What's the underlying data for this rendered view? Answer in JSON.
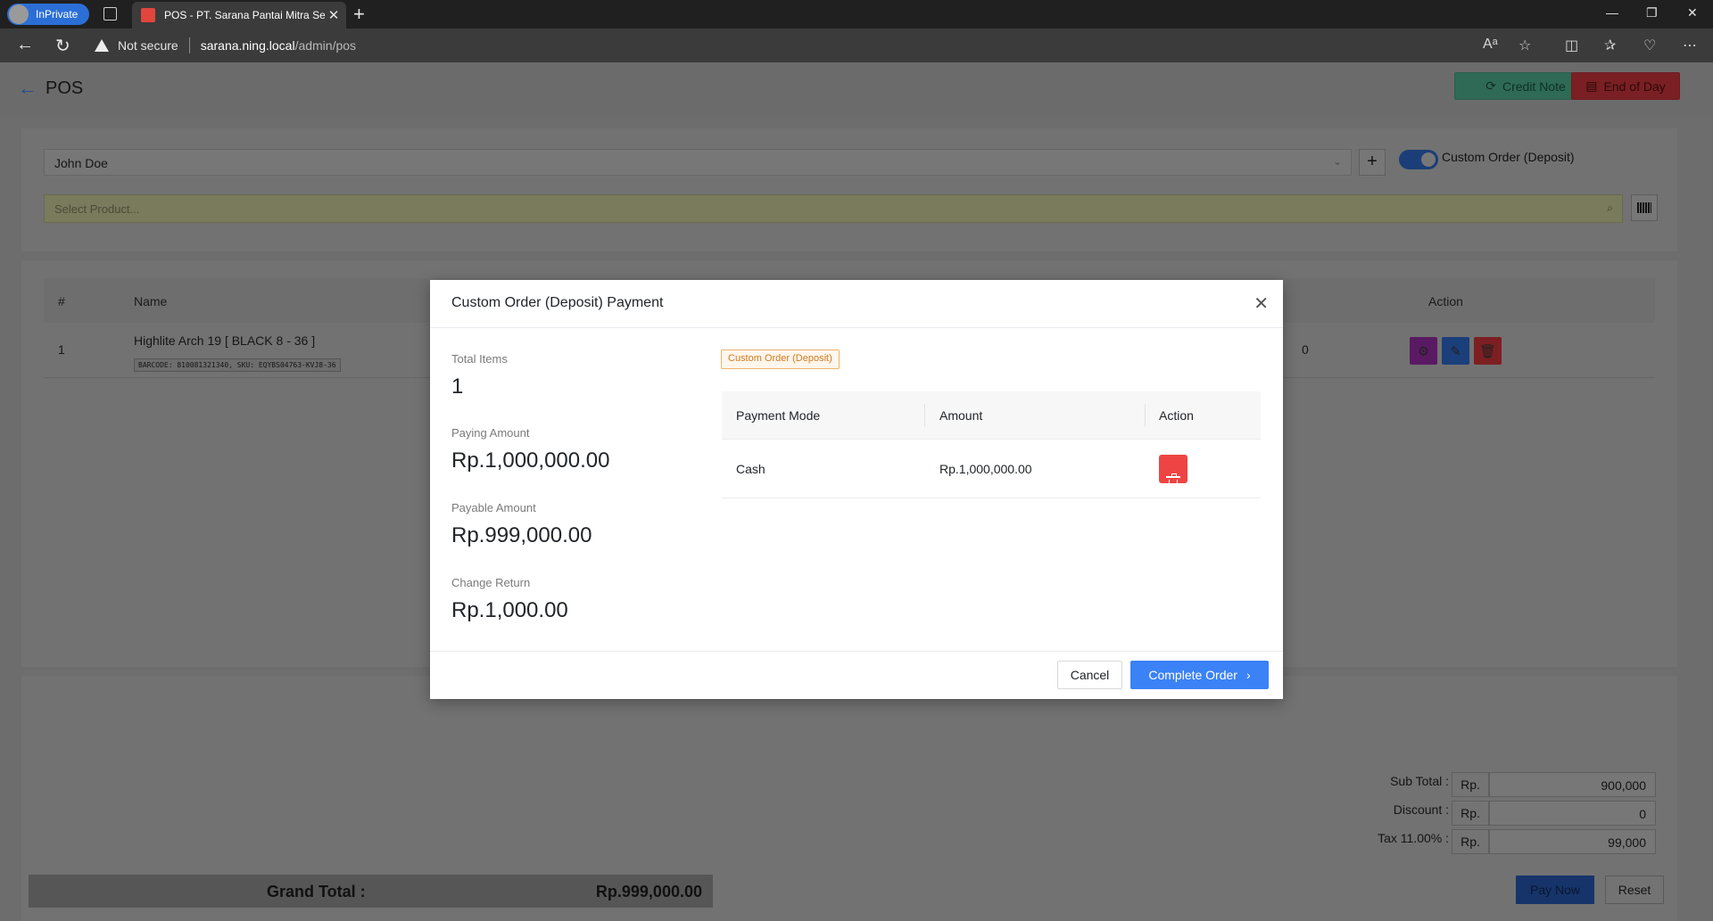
{
  "browser": {
    "inprivate_label": "InPrivate",
    "tab_title": "POS - PT. Sarana Pantai Mitra Se",
    "security_label": "Not secure",
    "url_host": "sarana.ning.local",
    "url_path": "/admin/pos"
  },
  "header": {
    "title": "POS",
    "credit_note_label": "Credit Note",
    "end_of_day_label": "End of Day"
  },
  "order_form": {
    "customer": "John Doe",
    "custom_order_label": "Custom Order (Deposit)",
    "custom_order_enabled": true,
    "product_placeholder": "Select Product..."
  },
  "items_table": {
    "columns": {
      "index": "#",
      "name": "Name",
      "action": "Action"
    },
    "rows": [
      {
        "index": "1",
        "name": "Highlite Arch 19 [ BLACK 8 - 36 ]",
        "meta": "BARCODE: 810081321340, SKU: EQYBS04763-KVJ8-36",
        "partial_value": "0"
      }
    ]
  },
  "totals": {
    "sub_total_label": "Sub Total :",
    "sub_total": "900,000",
    "discount_label": "Discount :",
    "discount": "0",
    "tax_label": "Tax 11.00% :",
    "tax": "99,000",
    "currency_prefix": "Rp.",
    "grand_total_label": "Grand Total :",
    "grand_total": "Rp.999,000.00",
    "pay_now_label": "Pay Now",
    "reset_label": "Reset"
  },
  "modal": {
    "title": "Custom Order (Deposit) Payment",
    "total_items_label": "Total Items",
    "total_items": "1",
    "paying_amount_label": "Paying Amount",
    "paying_amount": "Rp.1,000,000.00",
    "payable_amount_label": "Payable Amount",
    "payable_amount": "Rp.999,000.00",
    "change_return_label": "Change Return",
    "change_return": "Rp.1,000.00",
    "badge": "Custom Order (Deposit)",
    "payments_table": {
      "columns": {
        "mode": "Payment Mode",
        "amount": "Amount",
        "action": "Action"
      },
      "rows": [
        {
          "mode": "Cash",
          "amount": "Rp.1,000,000.00"
        }
      ]
    },
    "cancel_label": "Cancel",
    "complete_label": "Complete Order"
  },
  "colors": {
    "primary": "#3b82f6",
    "danger": "#ef4444",
    "success": "#22c55e",
    "badge_orange": "#d27a1d"
  }
}
